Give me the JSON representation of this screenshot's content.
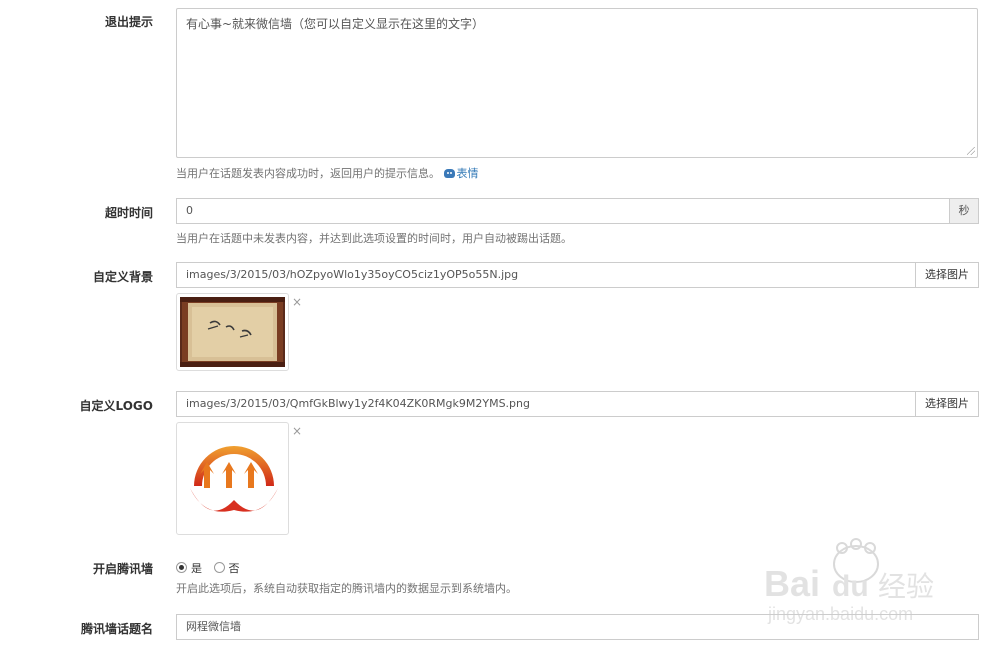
{
  "exit_tip": {
    "label": "退出提示",
    "value": "有心事~就来微信墙（您可以自定义显示在这里的文字）",
    "help": "当用户在话题发表内容成功时，返回用户的提示信息。",
    "emoji_link": "表情"
  },
  "timeout": {
    "label": "超时时间",
    "value": "0",
    "unit": "秒",
    "help": "当用户在话题中未发表内容，并达到此选项设置的时间时，用户自动被踢出话题。"
  },
  "background": {
    "label": "自定义背景",
    "value": "images/3/2015/03/hOZpyoWlo1y35oyCO5ciz1yOP5o55N.jpg",
    "button": "选择图片",
    "close": "×"
  },
  "logo": {
    "label": "自定义LOGO",
    "value": "images/3/2015/03/QmfGkBlwy1y2f4K04ZK0RMgk9M2YMS.png",
    "button": "选择图片",
    "close": "×"
  },
  "tencent_wall": {
    "label": "开启腾讯墙",
    "options": [
      "是",
      "否"
    ],
    "selected": "是",
    "help": "开启此选项后，系统自动获取指定的腾讯墙内的数据显示到系统墙内。"
  },
  "topic_name": {
    "label": "腾讯墙话题名",
    "value": "网程微信墙"
  },
  "watermark": {
    "brand_a": "Bai",
    "brand_b": "du",
    "brand_cn": "经验",
    "url": "jingyan.baidu.com"
  },
  "colors": {
    "border": "#cccccc",
    "help_text": "#737373",
    "link": "#337ab7",
    "addon_bg": "#eeeeee"
  }
}
